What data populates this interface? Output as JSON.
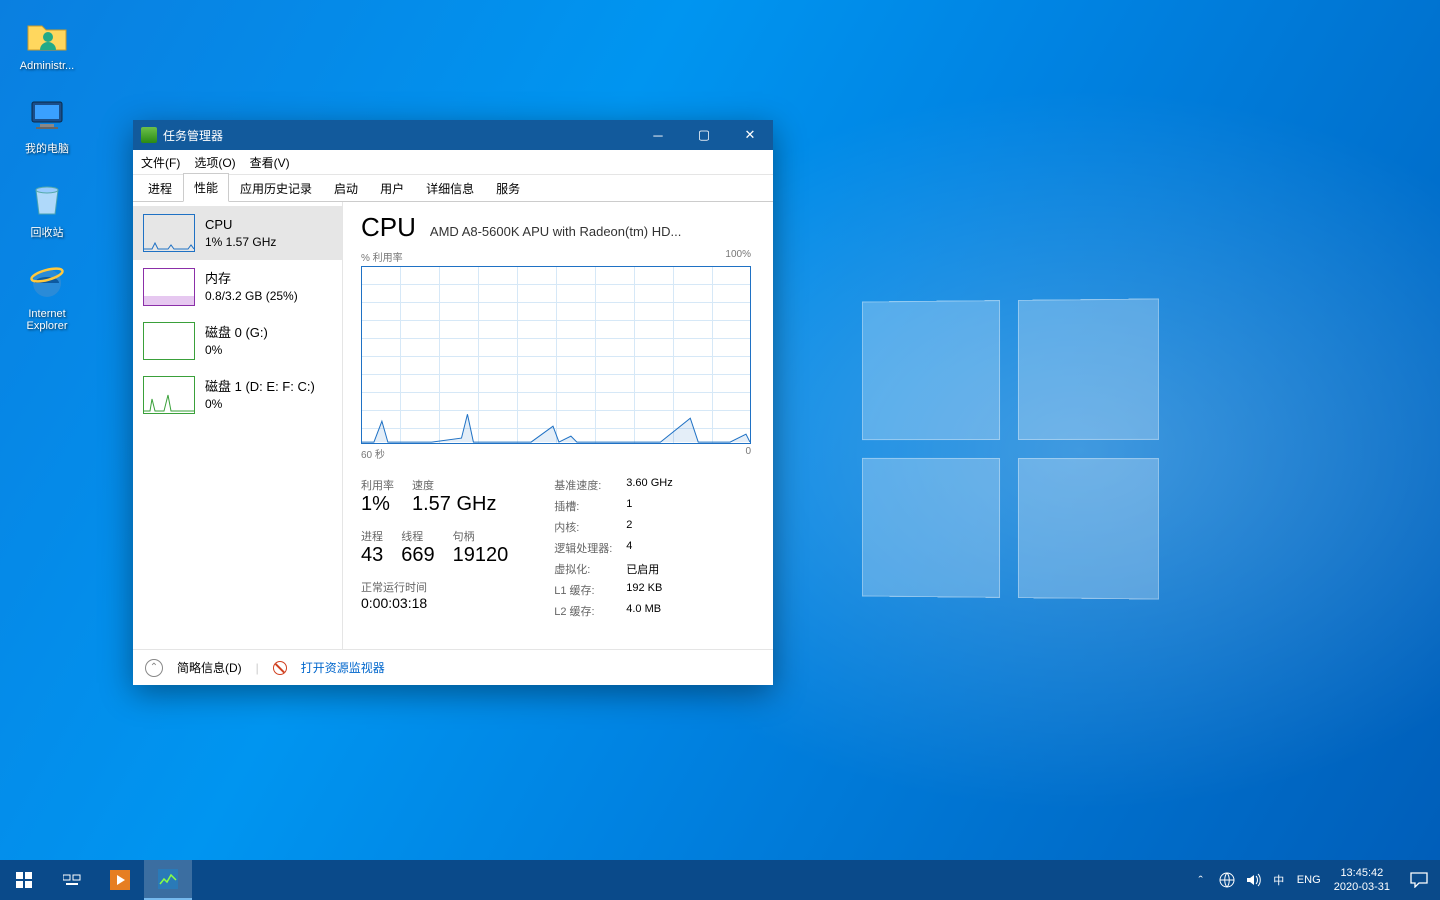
{
  "desktop": {
    "icons": [
      {
        "label": "Administr..."
      },
      {
        "label": "我的电脑"
      },
      {
        "label": "回收站"
      },
      {
        "label": "Internet\nExplorer"
      }
    ]
  },
  "window": {
    "title": "任务管理器",
    "menu": [
      "文件(F)",
      "选项(O)",
      "查看(V)"
    ],
    "tabs": [
      "进程",
      "性能",
      "应用历史记录",
      "启动",
      "用户",
      "详细信息",
      "服务"
    ],
    "activeTab": 1,
    "sidebar": [
      {
        "title": "CPU",
        "sub": "1% 1.57 GHz",
        "color": "#1f71c4"
      },
      {
        "title": "内存",
        "sub": "0.8/3.2 GB (25%)",
        "color": "#8b2fa8"
      },
      {
        "title": "磁盘 0 (G:)",
        "sub": "0%",
        "color": "#3aa03a"
      },
      {
        "title": "磁盘 1 (D: E: F: C:)",
        "sub": "0%",
        "color": "#3aa03a"
      }
    ],
    "main": {
      "heading": "CPU",
      "subtitle": "AMD A8-5600K APU with Radeon(tm) HD...",
      "yLabelL": "% 利用率",
      "yLabelR": "100%",
      "xLabelL": "60 秒",
      "xLabelR": "0",
      "stats": {
        "util_l": "利用率",
        "util_v": "1%",
        "speed_l": "速度",
        "speed_v": "1.57 GHz",
        "proc_l": "进程",
        "proc_v": "43",
        "thr_l": "线程",
        "thr_v": "669",
        "hnd_l": "句柄",
        "hnd_v": "19120",
        "up_l": "正常运行时间",
        "up_v": "0:00:03:18"
      },
      "kv": [
        [
          "基准速度:",
          "3.60 GHz"
        ],
        [
          "插槽:",
          "1"
        ],
        [
          "内核:",
          "2"
        ],
        [
          "逻辑处理器:",
          "4"
        ],
        [
          "虚拟化:",
          "已启用"
        ],
        [
          "L1 缓存:",
          "192 KB"
        ],
        [
          "L2 缓存:",
          "4.0 MB"
        ]
      ]
    },
    "footer": {
      "brief": "简略信息(D)",
      "link": "打开资源监视器"
    }
  },
  "taskbar": {
    "lang": "ENG",
    "time": "13:45:42",
    "date": "2020-03-31"
  }
}
